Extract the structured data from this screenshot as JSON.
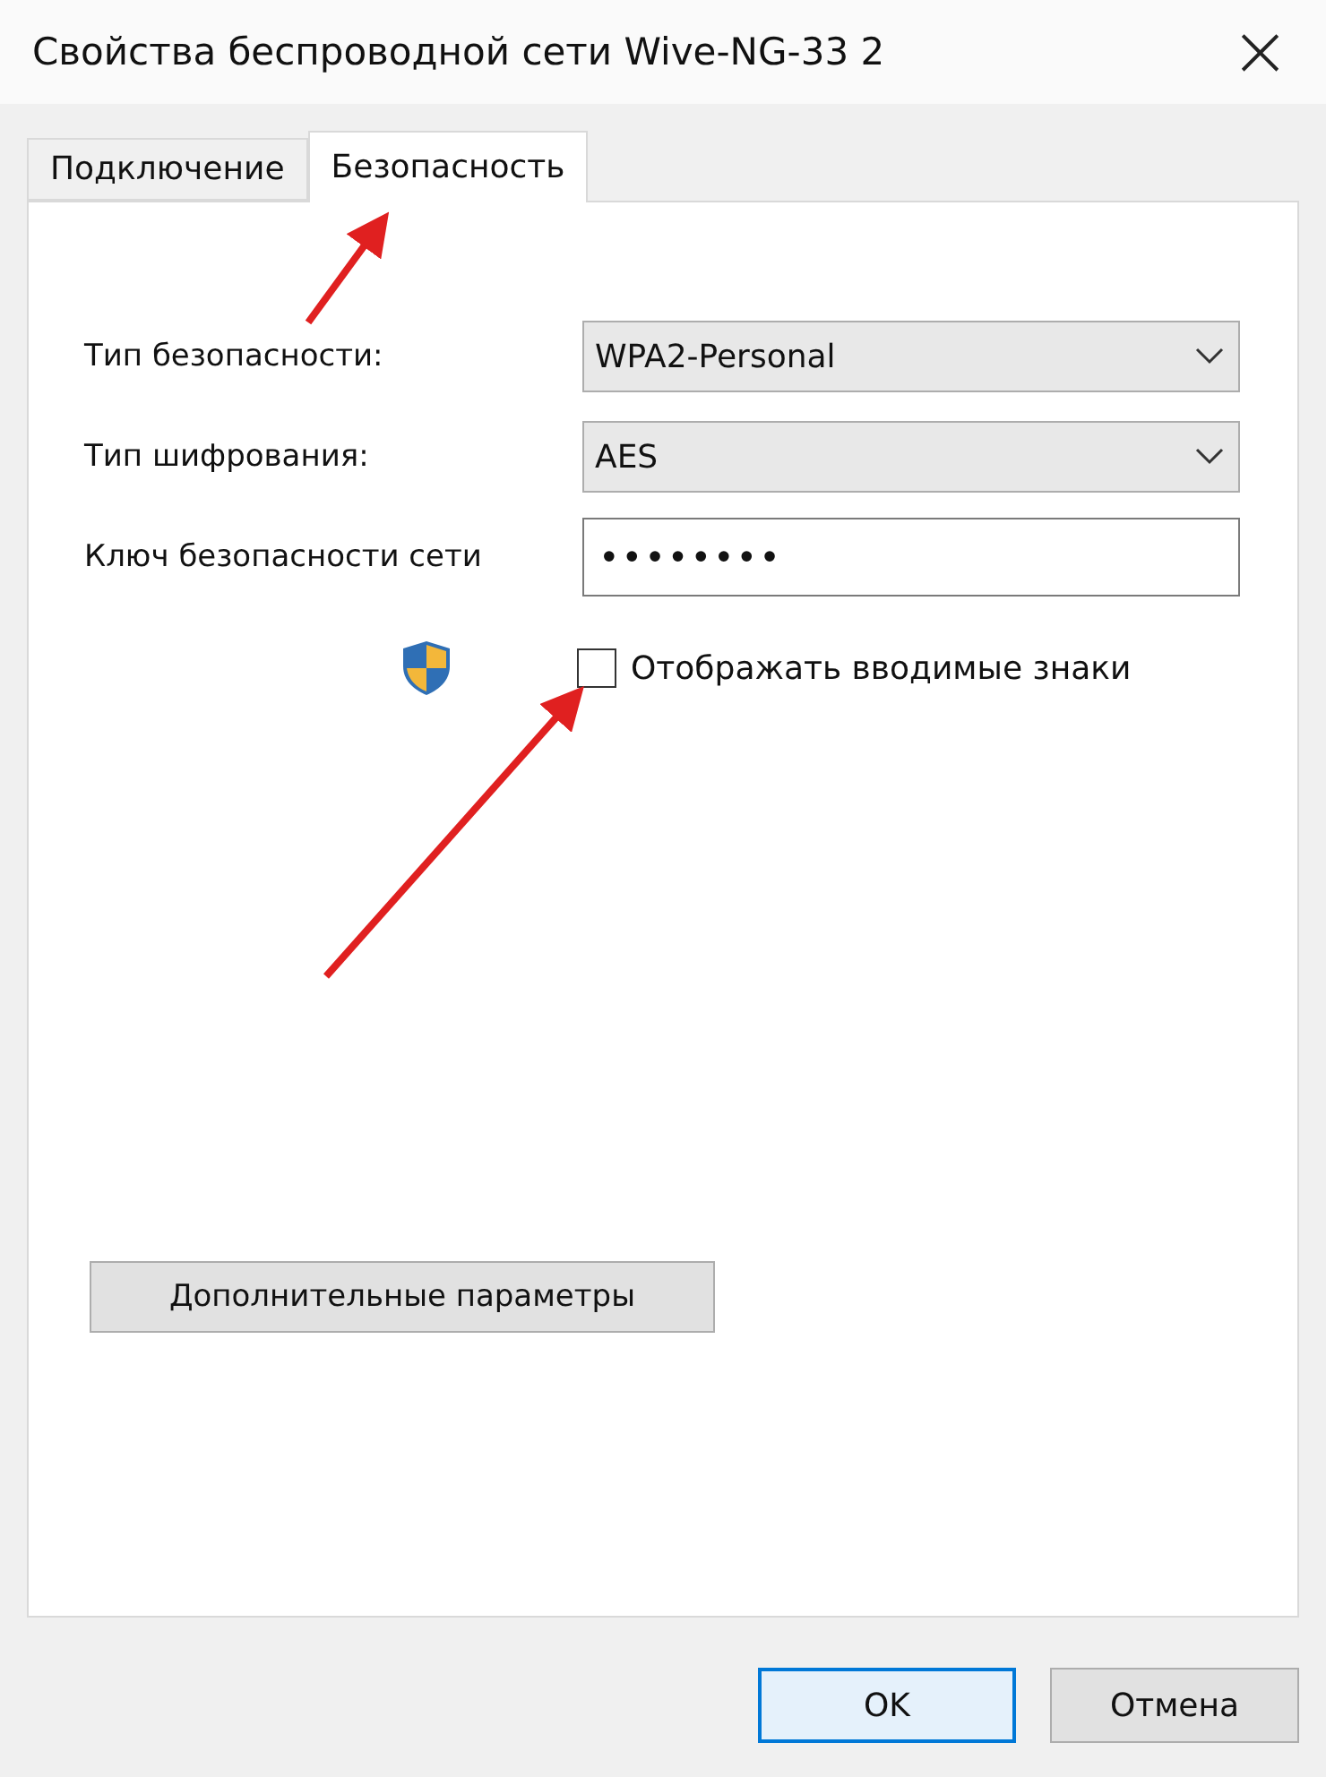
{
  "window": {
    "title": "Свойства беспроводной сети Wive-NG-33 2",
    "close": "×"
  },
  "tabs": [
    {
      "label": "Подключение",
      "selected": false
    },
    {
      "label": "Безопасность",
      "selected": true
    }
  ],
  "fields": [
    {
      "kind": "select",
      "label": "Тип безопасности:",
      "value": "WPA2-Personal"
    },
    {
      "kind": "select",
      "label": "Тип шифрования:",
      "value": "AES"
    },
    {
      "kind": "password",
      "label": "Ключ безопасности сети",
      "value": "••••••••"
    }
  ],
  "show_characters": {
    "label": "Отображать вводимые знаки",
    "checked": false
  },
  "advanced_button": "Дополнительные параметры",
  "buttons": [
    {
      "label": "OK",
      "default": true
    },
    {
      "label": "Отмена",
      "default": false
    }
  ]
}
